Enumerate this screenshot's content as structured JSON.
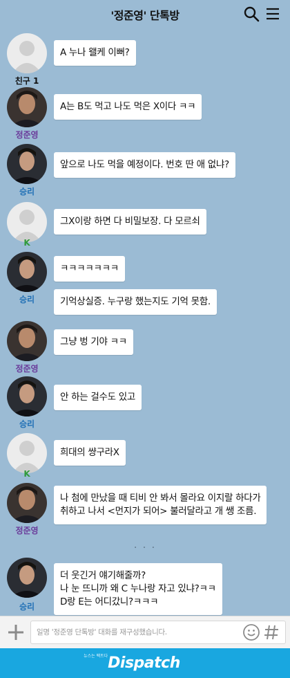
{
  "header": {
    "title": "'정준영' 단톡방",
    "icons": [
      "search-icon",
      "menu-icon"
    ]
  },
  "messages": [
    {
      "sender": "친구 1",
      "avatar": "default",
      "name_color": "#111111",
      "texts": [
        "A 누나 왤케 이뻐?"
      ]
    },
    {
      "sender": "정준영",
      "avatar": "photo-jjy",
      "name_color": "#6a3a9a",
      "texts": [
        "A는 B도 먹고 나도 먹은 X이다 ㅋㅋ"
      ]
    },
    {
      "sender": "승리",
      "avatar": "photo-sr",
      "name_color": "#1f6fb5",
      "texts": [
        "앞으로 나도 먹을 예정이다. 번호 딴 애 없냐?"
      ]
    },
    {
      "sender": "K",
      "avatar": "default",
      "name_color": "#2f9a3a",
      "texts": [
        "그X이랑 하면 다 비밀보장. 다 모르쇠"
      ]
    },
    {
      "sender": "승리",
      "avatar": "photo-sr",
      "name_color": "#1f6fb5",
      "texts": [
        "ㅋㅋㅋㅋㅋㅋㅋ",
        "기억상실증. 누구랑 했는지도 기억 못함."
      ]
    },
    {
      "sender": "정준영",
      "avatar": "photo-jjy",
      "name_color": "#6a3a9a",
      "texts": [
        "그냥 벙   기야 ㅋㅋ"
      ]
    },
    {
      "sender": "승리",
      "avatar": "photo-sr",
      "name_color": "#1f6fb5",
      "texts": [
        "안 하는 걸수도 있고"
      ]
    },
    {
      "sender": "K",
      "avatar": "default",
      "name_color": "#2f9a3a",
      "texts": [
        "희대의 썅구라X"
      ]
    },
    {
      "sender": "정준영",
      "avatar": "photo-jjy",
      "name_color": "#6a3a9a",
      "texts": [
        "나 첨에 만났을 때 티비 안 봐서 몰라요 이지랄 하다가\n취하고 나서 <먼지가 되어> 불러달라고 개 쌩 조름."
      ]
    },
    {
      "sender": "승리",
      "avatar": "photo-sr",
      "name_color": "#1f6fb5",
      "texts": [
        "더 웃긴거 얘기해줄까?\n나 눈 뜨니까 왜 C 누나랑 자고 있냐?ㅋㅋ\nD랑 E는 어디갔니?ㅋㅋㅋ"
      ]
    }
  ],
  "ellipsis": "· · ·",
  "input": {
    "placeholder": "일명 '정준영 단톡방' 대화를 재구성했습니다.",
    "icons": [
      "plus-icon",
      "emoji-icon",
      "hash-icon"
    ]
  },
  "footer": {
    "brand": "Dispatch",
    "tagline": "뉴스는 팩트다"
  },
  "colors": {
    "background": "#9bbbd4",
    "bubble": "#ffffff",
    "footer": "#19a7e0"
  }
}
